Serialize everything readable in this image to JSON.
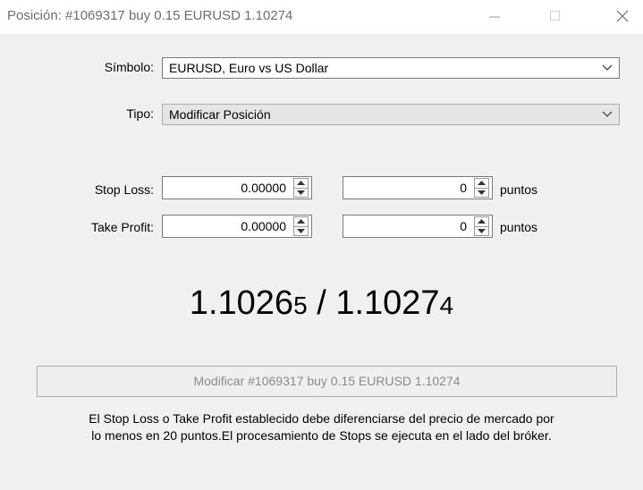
{
  "window": {
    "title": "Posición: #1069317 buy 0.15 EURUSD 1.10274",
    "minimize_glyph": "—",
    "maximize_glyph": "☐",
    "close_glyph": "✕"
  },
  "form": {
    "symbol_label": "Símbolo:",
    "symbol_value": "EURUSD, Euro vs US Dollar",
    "type_label": "Tipo:",
    "type_value": "Modificar Posición",
    "stop_loss_label": "Stop Loss:",
    "stop_loss_price": "0.00000",
    "stop_loss_points": "0",
    "take_profit_label": "Take Profit:",
    "take_profit_price": "0.00000",
    "take_profit_points": "0",
    "points_unit": "puntos"
  },
  "quote": {
    "bid_main": "1.1026",
    "bid_last": "5",
    "separator": " / ",
    "ask_main": "1.1027",
    "ask_last": "4"
  },
  "modify_button": {
    "label": "Modificar #1069317 buy 0.15 EURUSD 1.10274",
    "enabled": false
  },
  "note": {
    "line1": "El Stop Loss o Take Profit establecido debe diferenciarse del precio de mercado por",
    "line2": "lo menos en 20 puntos.El procesamiento de Stops se ejecuta en el lado del bróker."
  },
  "icons": {
    "combo_arrow": "chevron-down-icon",
    "spin_up": "spin-up-icon",
    "spin_down": "spin-down-icon"
  },
  "colors": {
    "title_text": "#6d6d6d",
    "disabled_text": "#8a8a8a",
    "window_bg": "#f0f0f0"
  }
}
